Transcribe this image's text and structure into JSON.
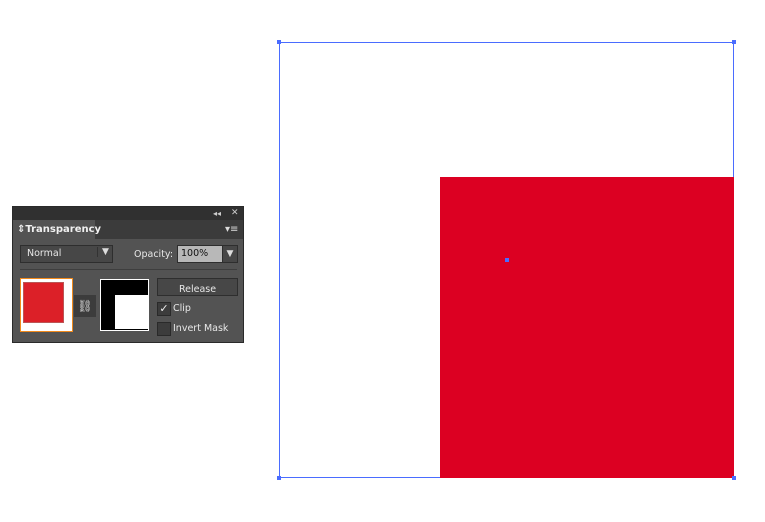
{
  "panel": {
    "title": "Transparency",
    "collapse_icon": "double-chevron-left-icon",
    "close_icon": "close-icon",
    "menu_icon": "panel-menu-icon",
    "blend_mode": "Normal",
    "opacity_label": "Opacity:",
    "opacity_value": "100%",
    "release_label": "Release",
    "clip_label": "Clip",
    "clip_checked": true,
    "invert_mask_label": "Invert Mask",
    "invert_mask_checked": false
  },
  "canvas": {
    "object_color": "#dc0022",
    "selection_color": "#4a6cff"
  }
}
